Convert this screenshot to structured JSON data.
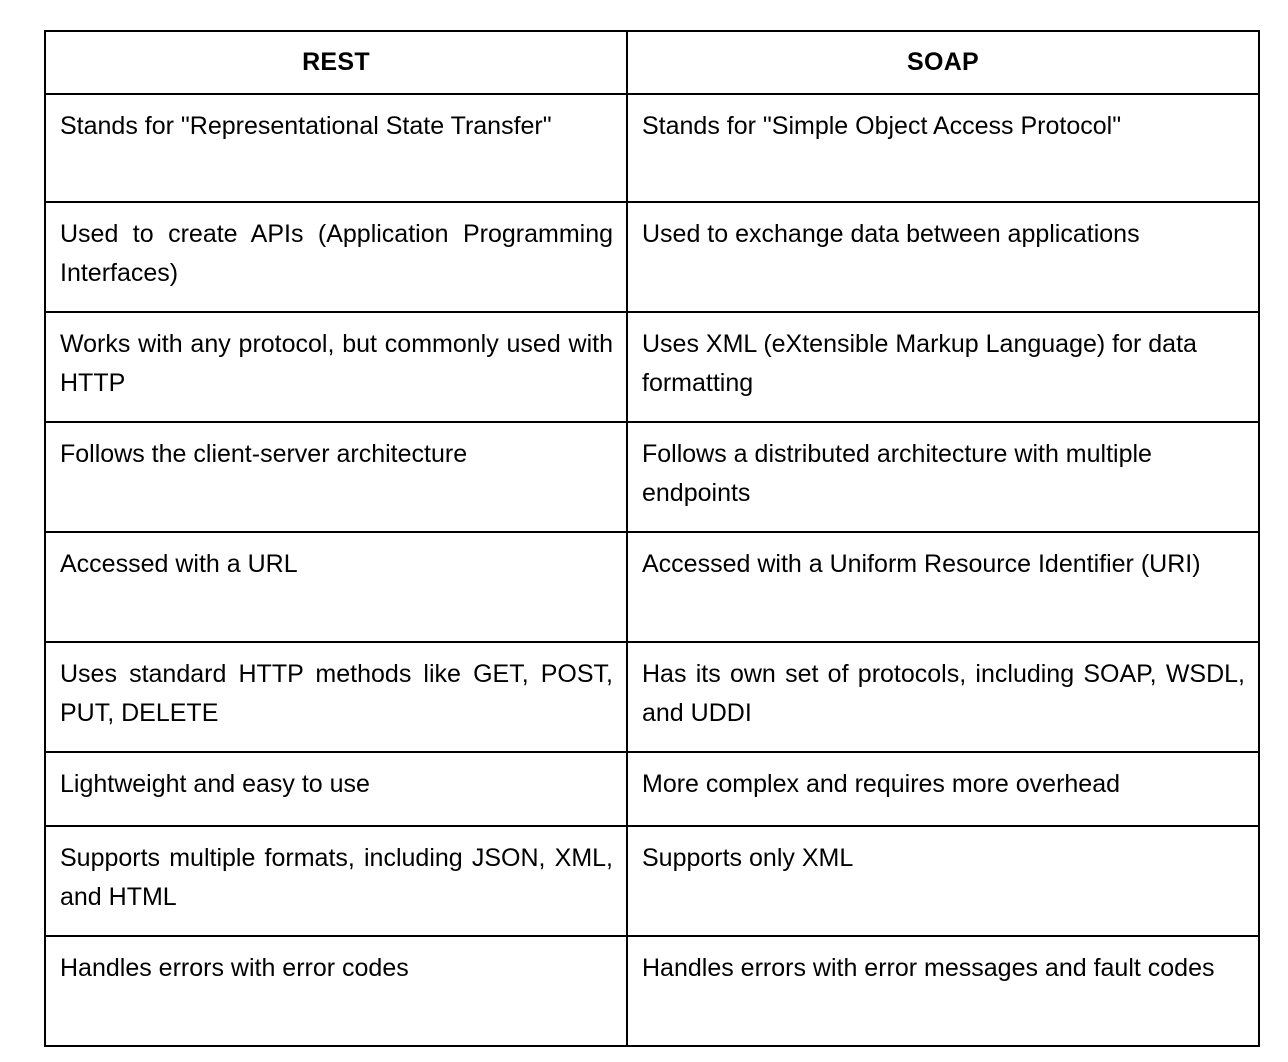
{
  "table": {
    "headers": [
      {
        "label": "REST"
      },
      {
        "label": "SOAP"
      }
    ],
    "rows": [
      {
        "rest": "Stands for \"Representational State Transfer\"",
        "soap": "Stands for \"Simple Object Access Protocol\""
      },
      {
        "rest": "Used to create APIs (Application Programming Interfaces)",
        "soap": "Used to exchange data between applications"
      },
      {
        "rest": "Works with any protocol, but commonly used with HTTP",
        "soap": "Uses XML (eXtensible Markup Language) for data formatting"
      },
      {
        "rest": "Follows the client-server architecture",
        "soap": "Follows a distributed architecture with multiple endpoints"
      },
      {
        "rest": "Accessed with a URL",
        "soap": "Accessed with a Uniform Resource Identifier (URI)"
      },
      {
        "rest": "Uses standard HTTP methods like GET, POST, PUT, DELETE",
        "soap": "Has its own set of protocols, including SOAP, WSDL, and UDDI"
      },
      {
        "rest": "Lightweight and easy to use",
        "soap": "More complex and requires more overhead"
      },
      {
        "rest": "Supports multiple formats, including JSON, XML, and HTML",
        "soap": "Supports only XML"
      },
      {
        "rest": "Handles errors with error codes",
        "soap": "Handles errors with error messages and fault codes"
      }
    ]
  },
  "colors": {
    "border": "#000000",
    "text": "#000000",
    "background": "#ffffff"
  }
}
